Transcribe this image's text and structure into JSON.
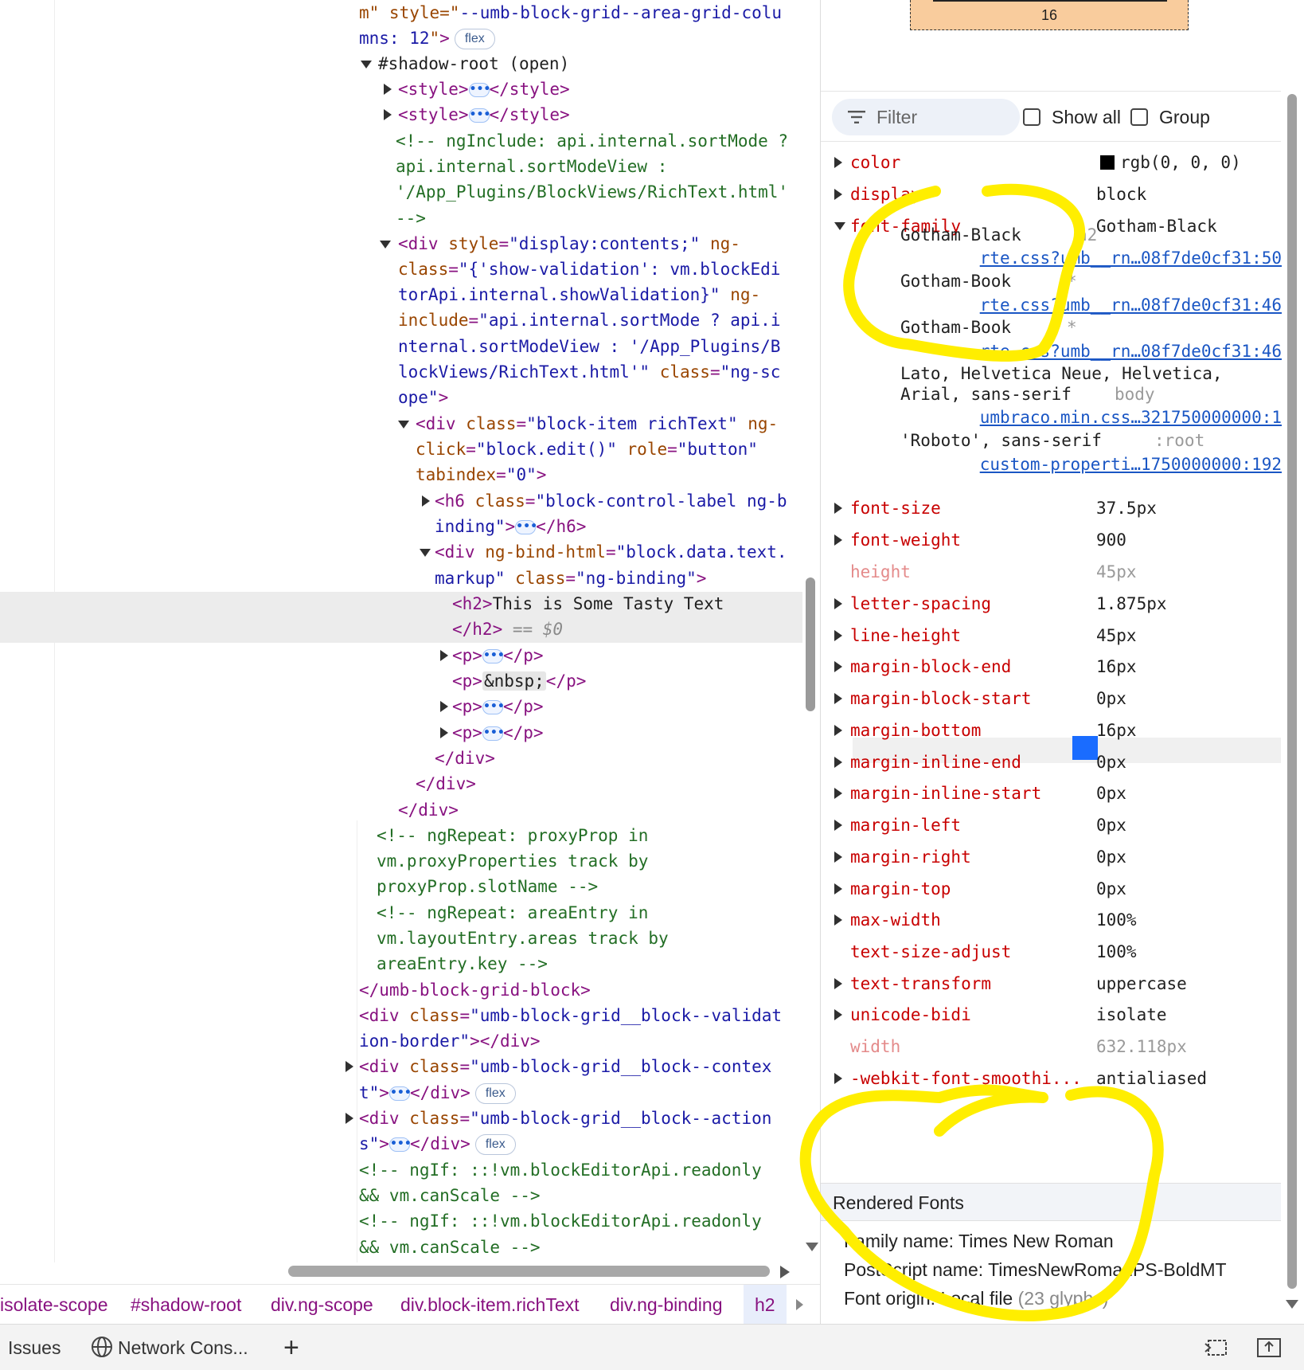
{
  "elements": {
    "lines": [
      {
        "segs": [
          [
            "attr",
            "m\" style=\""
          ],
          [
            "val",
            "--umb-block-grid--area-grid-colu"
          ]
        ]
      },
      {
        "segs": [
          [
            "val",
            "mns: 12"
          ],
          [
            "attr",
            "\""
          ],
          [
            "tag",
            ">"
          ]
        ],
        "badge": "flex"
      },
      {
        "segs": [
          [
            "txt",
            "#shadow-root (open)"
          ]
        ]
      },
      {
        "segs": [
          [
            "tag",
            "<style>"
          ]
        ],
        "ell": true,
        "after": [
          [
            "tag",
            "</style>"
          ]
        ]
      },
      {
        "segs": [
          [
            "tag",
            "<style>"
          ]
        ],
        "ell": true,
        "after": [
          [
            "tag",
            "</style>"
          ]
        ]
      },
      {
        "segs": [
          [
            "cmt",
            "<!-- ngInclude: api.internal.sortMode ?"
          ]
        ]
      },
      {
        "segs": [
          [
            "cmt",
            "api.internal.sortModeView :"
          ]
        ]
      },
      {
        "segs": [
          [
            "cmt",
            "'/App_Plugins/BlockViews/RichText.html'"
          ]
        ]
      },
      {
        "segs": [
          [
            "cmt",
            "-->"
          ]
        ]
      },
      {
        "segs": [
          [
            "tag",
            "<div "
          ],
          [
            "attr",
            "style"
          ],
          [
            "tag",
            "="
          ],
          [
            "val",
            "\"display:contents;\""
          ],
          [
            "attr",
            " ng-"
          ]
        ]
      },
      {
        "segs": [
          [
            "attr",
            "class"
          ],
          [
            "tag",
            "="
          ],
          [
            "val",
            "\"{'show-validation': vm.blockEdi"
          ]
        ]
      },
      {
        "segs": [
          [
            "val",
            "torApi.internal.showValidation}\""
          ],
          [
            "attr",
            " ng-"
          ]
        ]
      },
      {
        "segs": [
          [
            "attr",
            "include"
          ],
          [
            "tag",
            "="
          ],
          [
            "val",
            "\"api.internal.sortMode ? api.i"
          ]
        ]
      },
      {
        "segs": [
          [
            "val",
            "nternal.sortModeView : '/App_Plugins/B"
          ]
        ]
      },
      {
        "segs": [
          [
            "val",
            "lockViews/RichText.html'\""
          ],
          [
            "attr",
            " class"
          ],
          [
            "tag",
            "="
          ],
          [
            "val",
            "\"ng-sc"
          ]
        ]
      },
      {
        "segs": [
          [
            "val",
            "ope\""
          ],
          [
            "tag",
            ">"
          ]
        ]
      },
      {
        "segs": [
          [
            "tag",
            "<div "
          ],
          [
            "attr",
            "class"
          ],
          [
            "tag",
            "="
          ],
          [
            "val",
            "\"block-item richText\""
          ],
          [
            "attr",
            " ng-"
          ]
        ]
      },
      {
        "segs": [
          [
            "attr",
            "click"
          ],
          [
            "tag",
            "="
          ],
          [
            "val",
            "\"block.edit()\""
          ],
          [
            "attr",
            " role"
          ],
          [
            "tag",
            "="
          ],
          [
            "val",
            "\"button\""
          ]
        ]
      },
      {
        "segs": [
          [
            "attr",
            "tabindex"
          ],
          [
            "tag",
            "="
          ],
          [
            "val",
            "\"0\""
          ],
          [
            "tag",
            ">"
          ]
        ]
      },
      {
        "segs": [
          [
            "tag",
            "<h6 "
          ],
          [
            "attr",
            "class"
          ],
          [
            "tag",
            "="
          ],
          [
            "val",
            "\"block-control-label ng-b"
          ]
        ]
      },
      {
        "segs": [
          [
            "val",
            "inding\""
          ],
          [
            "tag",
            ">"
          ]
        ],
        "ell": true,
        "after": [
          [
            "tag",
            "</h6>"
          ]
        ]
      },
      {
        "segs": [
          [
            "tag",
            "<div "
          ],
          [
            "attr",
            "ng-bind-html"
          ],
          [
            "tag",
            "="
          ],
          [
            "val",
            "\"block.data.text."
          ]
        ]
      },
      {
        "segs": [
          [
            "val",
            "markup\""
          ],
          [
            "attr",
            " class"
          ],
          [
            "tag",
            "="
          ],
          [
            "val",
            "\"ng-binding\""
          ],
          [
            "tag",
            ">"
          ]
        ]
      },
      {
        "segs": [
          [
            "tag",
            "<h2>"
          ],
          [
            "txt",
            "This is Some Tasty Text"
          ]
        ]
      },
      {
        "segs": [
          [
            "tag",
            "</h2>"
          ],
          [
            "dim",
            " == $0"
          ]
        ]
      },
      {
        "segs": [
          [
            "tag",
            "<p>"
          ]
        ],
        "ell": true,
        "after": [
          [
            "tag",
            "</p>"
          ]
        ]
      },
      {
        "segs": [
          [
            "tag",
            "<p>"
          ],
          [
            "nbsp",
            "&nbsp;"
          ],
          [
            "tag",
            "</p>"
          ]
        ]
      },
      {
        "segs": [
          [
            "tag",
            "<p>"
          ]
        ],
        "ell": true,
        "after": [
          [
            "tag",
            "</p>"
          ]
        ]
      },
      {
        "segs": [
          [
            "tag",
            "<p>"
          ]
        ],
        "ell": true,
        "after": [
          [
            "tag",
            "</p>"
          ]
        ]
      },
      {
        "segs": [
          [
            "tag",
            "</div>"
          ]
        ]
      },
      {
        "segs": [
          [
            "tag",
            "</div>"
          ]
        ]
      },
      {
        "segs": [
          [
            "tag",
            "</div>"
          ]
        ]
      },
      {
        "segs": [
          [
            "cmt",
            "<!-- ngRepeat: proxyProp in"
          ]
        ]
      },
      {
        "segs": [
          [
            "cmt",
            "vm.proxyProperties track by"
          ]
        ]
      },
      {
        "segs": [
          [
            "cmt",
            "proxyProp.slotName -->"
          ]
        ]
      },
      {
        "segs": [
          [
            "cmt",
            "<!-- ngRepeat: areaEntry in"
          ]
        ]
      },
      {
        "segs": [
          [
            "cmt",
            "vm.layoutEntry.areas track by"
          ]
        ]
      },
      {
        "segs": [
          [
            "cmt",
            "areaEntry.key -->"
          ]
        ]
      },
      {
        "segs": [
          [
            "tag",
            "</umb-block-grid-block>"
          ]
        ]
      },
      {
        "segs": [
          [
            "tag",
            "<div "
          ],
          [
            "attr",
            "class"
          ],
          [
            "tag",
            "="
          ],
          [
            "val",
            "\"umb-block-grid__block--validat"
          ]
        ]
      },
      {
        "segs": [
          [
            "val",
            "ion-border\""
          ],
          [
            "tag",
            "></div>"
          ]
        ]
      },
      {
        "segs": [
          [
            "tag",
            "<div "
          ],
          [
            "attr",
            "class"
          ],
          [
            "tag",
            "="
          ],
          [
            "val",
            "\"umb-block-grid__block--contex"
          ]
        ]
      },
      {
        "segs": [
          [
            "val",
            "t\""
          ],
          [
            "tag",
            ">"
          ]
        ],
        "ell": true,
        "after": [
          [
            "tag",
            "</div>"
          ]
        ],
        "badge": "flex"
      },
      {
        "segs": [
          [
            "tag",
            "<div "
          ],
          [
            "attr",
            "class"
          ],
          [
            "tag",
            "="
          ],
          [
            "val",
            "\"umb-block-grid__block--action"
          ]
        ]
      },
      {
        "segs": [
          [
            "val",
            "s\""
          ],
          [
            "tag",
            ">"
          ]
        ],
        "ell": true,
        "after": [
          [
            "tag",
            "</div>"
          ]
        ],
        "badge": "flex"
      },
      {
        "segs": [
          [
            "cmt",
            "<!-- ngIf: ::!vm.blockEditorApi.readonly"
          ]
        ]
      },
      {
        "segs": [
          [
            "cmt",
            "&& vm.canScale -->"
          ]
        ]
      },
      {
        "segs": [
          [
            "cmt",
            "<!-- ngIf: ::!vm.blockEditorApi.readonly"
          ]
        ]
      },
      {
        "segs": [
          [
            "cmt",
            "&& vm.canScale -->"
          ]
        ]
      }
    ]
  },
  "breadcrumbs": [
    "isolate-scope",
    "#shadow-root",
    "div.ng-scope",
    "div.block-item.richText",
    "div.ng-binding",
    "h2"
  ],
  "drawer": {
    "issues": "Issues",
    "network": "Network Cons...",
    "add": "+"
  },
  "computed": {
    "box_value": "16",
    "filter_placeholder": "Filter",
    "show_all": "Show all",
    "group": "Group",
    "properties": [
      {
        "name": "color",
        "value": "rgb(0, 0, 0)",
        "swatch": "#000000"
      },
      {
        "name": "display",
        "value": "block"
      },
      {
        "name": "font-family",
        "value": "Gotham-Black",
        "expanded": true
      },
      {
        "name": "font-size",
        "value": "37.5px"
      },
      {
        "name": "font-weight",
        "value": "900"
      },
      {
        "name": "height",
        "value": "45px",
        "inherited": true
      },
      {
        "name": "letter-spacing",
        "value": "1.875px"
      },
      {
        "name": "line-height",
        "value": "45px"
      },
      {
        "name": "margin-block-end",
        "value": "16px"
      },
      {
        "name": "margin-block-start",
        "value": "0px"
      },
      {
        "name": "margin-bottom",
        "value": "16px"
      },
      {
        "name": "margin-inline-end",
        "value": "0px"
      },
      {
        "name": "margin-inline-start",
        "value": "0px"
      },
      {
        "name": "margin-left",
        "value": "0px"
      },
      {
        "name": "margin-right",
        "value": "0px"
      },
      {
        "name": "margin-top",
        "value": "0px"
      },
      {
        "name": "max-width",
        "value": "100%"
      },
      {
        "name": "text-size-adjust",
        "value": "100%",
        "no_arrow": true
      },
      {
        "name": "text-transform",
        "value": "uppercase"
      },
      {
        "name": "unicode-bidi",
        "value": "isolate"
      },
      {
        "name": "width",
        "value": "632.118px",
        "inherited": true
      },
      {
        "name": "-webkit-font-smoothi...",
        "value": "antialiased"
      }
    ],
    "font_family_trace": [
      {
        "value": "Gotham-Black",
        "selector": "h2",
        "source": "rte.css?umb__rn…08f7de0cf31:50"
      },
      {
        "value": "Gotham-Book",
        "selector": "*",
        "source": "rte.css?umb__rn…08f7de0cf31:46"
      },
      {
        "value": "Gotham-Book",
        "selector": "*",
        "source": "rte.css?umb__rn…08f7de0cf31:46"
      },
      {
        "value": "Lato, Helvetica Neue, Helvetica,",
        "value2": "Arial, sans-serif",
        "selector": "body",
        "source": "umbraco.min.css…321750000000:1"
      },
      {
        "value": "'Roboto', sans-serif",
        "selector": ":root",
        "source": "custom-properti…1750000000:192"
      }
    ],
    "rendered_fonts": {
      "heading": "Rendered Fonts",
      "family_label": "Family name: Times New Roman",
      "postscript_label": "PostScript name: TimesNewRomanPS-BoldMT",
      "origin_label": "Font origin: Local file",
      "origin_glyphs": "(23 glyphs)"
    }
  },
  "colors": {
    "annotation": "#ffee00",
    "tag": "#881280",
    "attr": "#994500",
    "value": "#1a1aa6",
    "comment": "#236e25",
    "prop": "#c80000"
  }
}
